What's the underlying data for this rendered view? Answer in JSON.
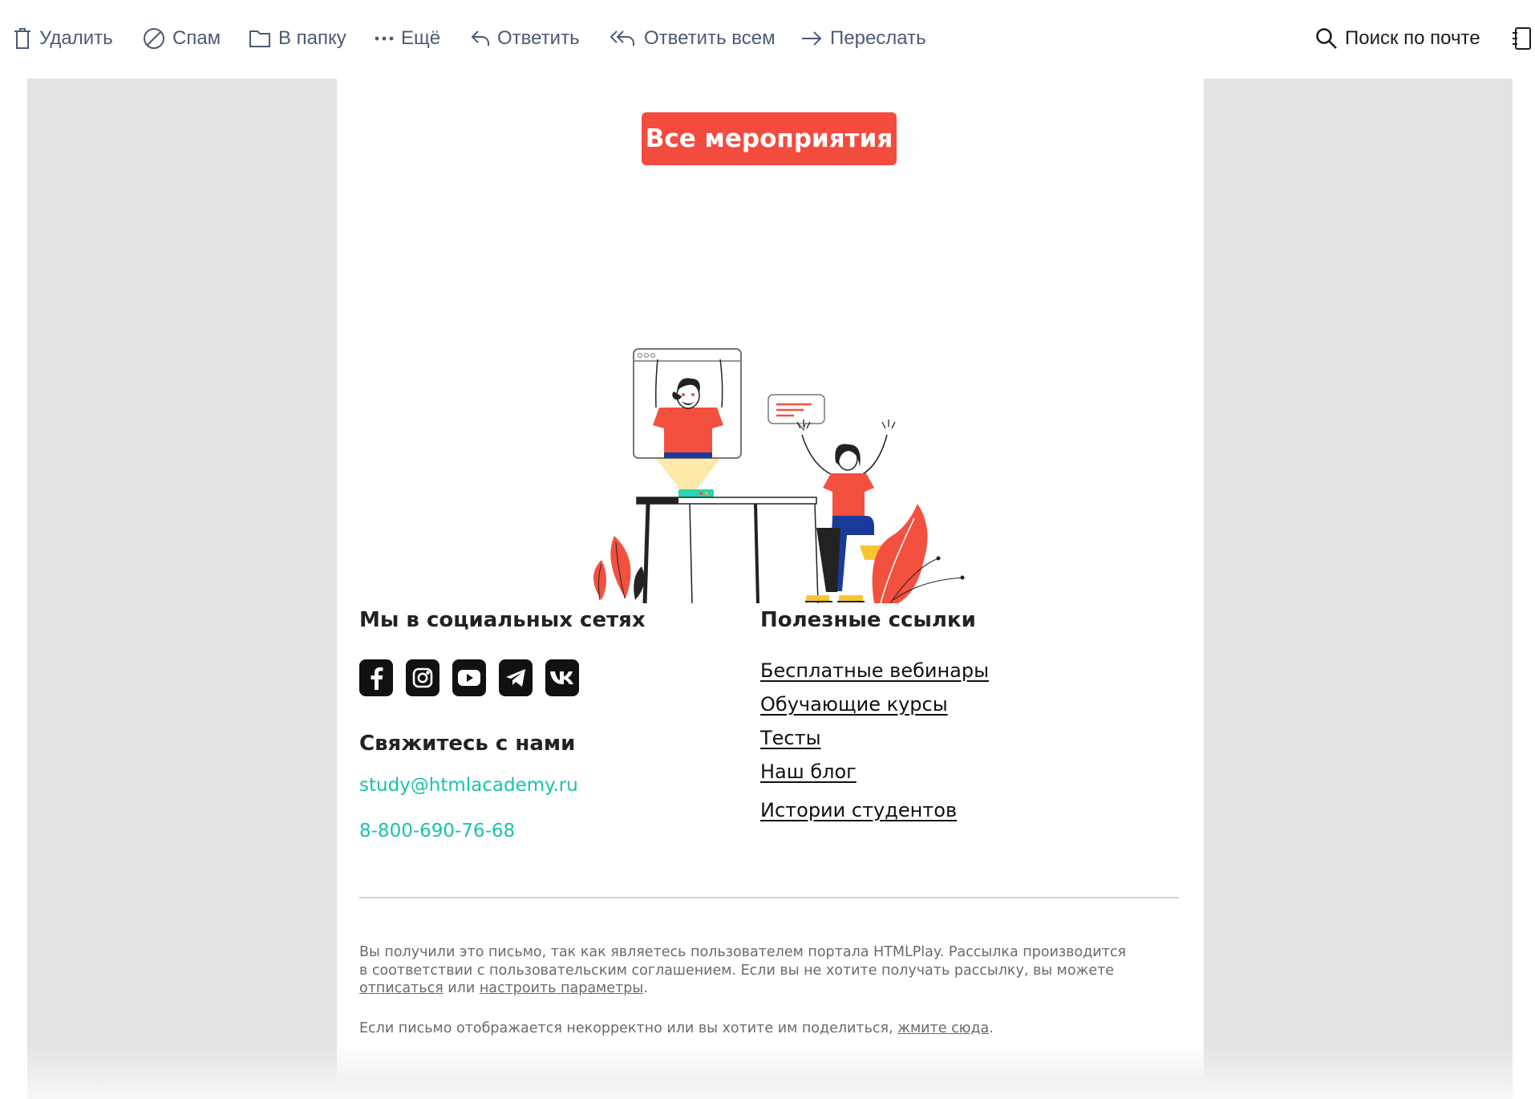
{
  "toolbar": {
    "delete": "Удалить",
    "spam": "Спам",
    "move_to_folder": "В папку",
    "more": "Ещё",
    "reply": "Ответить",
    "reply_all": "Ответить всем",
    "forward": "Переслать",
    "search": "Поиск по почте"
  },
  "email": {
    "cta_label": "Все мероприятия",
    "social_heading": "Мы в социальных сетях",
    "social_icons": [
      "facebook-icon",
      "instagram-icon",
      "youtube-icon",
      "telegram-icon",
      "vk-icon"
    ],
    "contact_heading": "Свяжитесь с нами",
    "email": "study@htmlacademy.ru",
    "phone": "8-800-690-76-68",
    "links_heading": "Полезные ссылки",
    "links": [
      "Бесплатные вебинары",
      "Обучающие курсы",
      "Тесты",
      "Наш блог",
      "Истории студентов"
    ],
    "footer": {
      "line1": "Вы получили это письмо, так как являетесь пользователем портала HTMLPlay. Рассылка производится",
      "line2": "в соответствии с пользовательским соглашением. Если вы не хотите получать рассылку, вы можете",
      "unsubscribe": "отписаться",
      "or": "или",
      "settings": "настроить параметры",
      "dot": ".",
      "line3": "Если письмо отображается некорректно или вы хотите им поделиться,",
      "click_here": "жмите сюда",
      "dot2": "."
    }
  },
  "colors": {
    "accent": "#f44b3f",
    "contact": "#18c3a8",
    "toolbar_text": "#4a5a78",
    "gutter": "#e3e3e3"
  }
}
